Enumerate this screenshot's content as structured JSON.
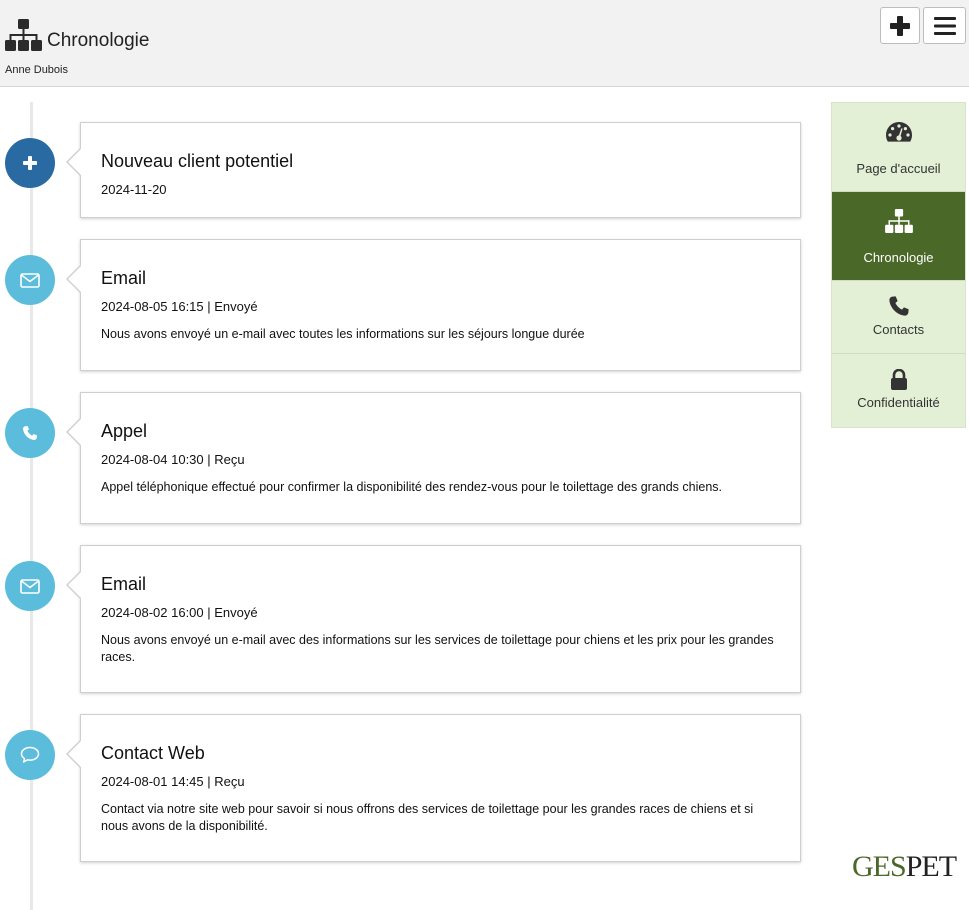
{
  "header": {
    "title": "Chronologie",
    "user": "Anne Dubois",
    "title_icon": "sitemap-icon",
    "add_icon": "plus-icon",
    "menu_icon": "hamburger-menu-icon"
  },
  "timeline": {
    "events": [
      {
        "icon": "plus-icon",
        "title": "Nouveau client potentiel",
        "meta": "2024-11-20",
        "description": ""
      },
      {
        "icon": "envelope-icon",
        "title": "Email",
        "meta": "2024-08-05 16:15 | Envoyé",
        "description": "Nous avons envoyé un e-mail avec toutes les informations sur les séjours longue durée"
      },
      {
        "icon": "phone-icon",
        "title": "Appel",
        "meta": "2024-08-04 10:30 | Reçu",
        "description": "Appel téléphonique effectué pour confirmer la disponibilité des rendez-vous pour le toilettage des grands chiens."
      },
      {
        "icon": "envelope-icon",
        "title": "Email",
        "meta": "2024-08-02 16:00 | Envoyé",
        "description": "Nous avons envoyé un e-mail avec des informations sur les services de toilettage pour chiens et les prix pour les grandes races."
      },
      {
        "icon": "chat-bubble-icon",
        "title": "Contact Web",
        "meta": "2024-08-01 14:45 | Reçu",
        "description": "Contact via notre site web pour savoir si nous offrons des services de toilettage pour les grandes races de chiens et si nous avons de la disponibilité."
      }
    ]
  },
  "sidebar": {
    "items": [
      {
        "label": "Page d'accueil",
        "icon": "dashboard-gauge-icon",
        "active": false
      },
      {
        "label": "Chronologie",
        "icon": "sitemap-icon",
        "active": true
      },
      {
        "label": "Contacts",
        "icon": "phone-icon",
        "active": false
      },
      {
        "label": "Confidentialité",
        "icon": "lock-icon",
        "active": false
      }
    ]
  },
  "logo": {
    "part1": "GES",
    "part2": "PET"
  },
  "colors": {
    "accent_green": "#4a6828",
    "nav_light_green": "#e3f0d6",
    "timeline_dark_blue": "#2a6aa3",
    "timeline_light_blue": "#5bbddb"
  }
}
